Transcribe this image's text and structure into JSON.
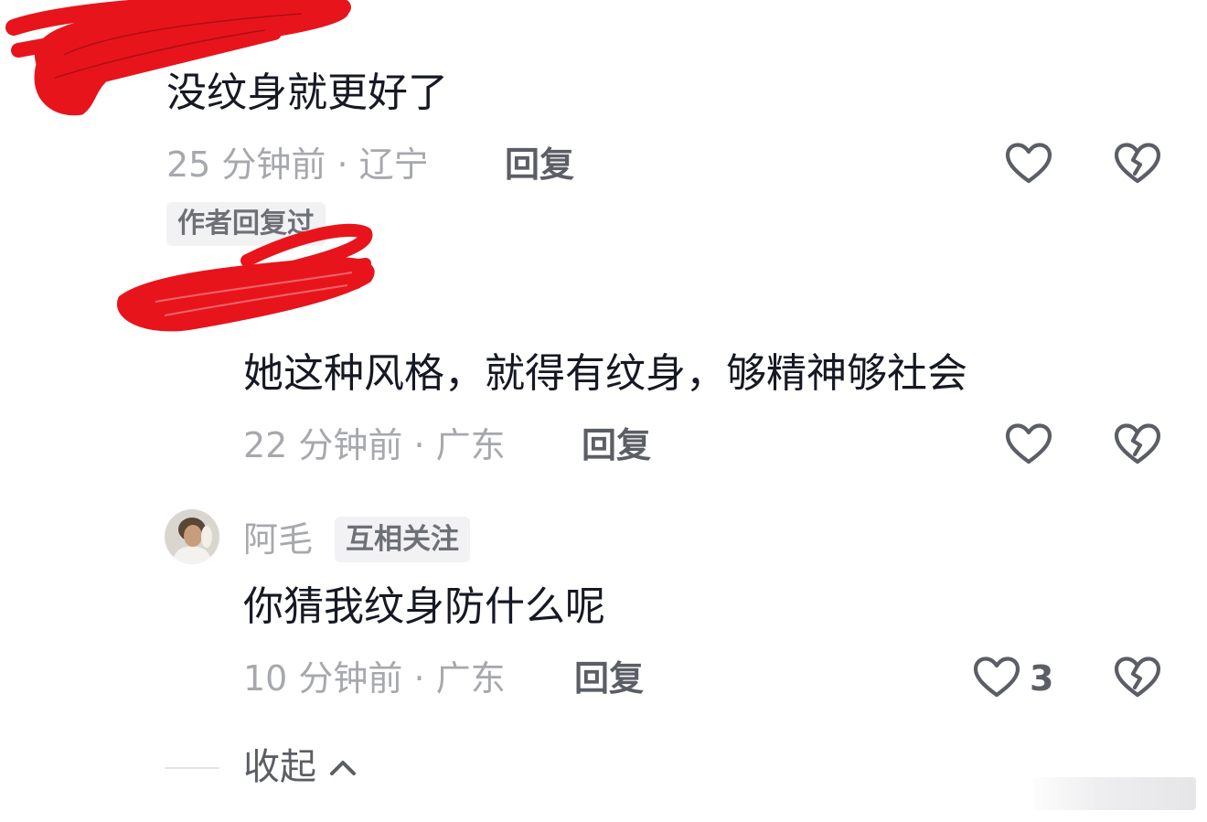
{
  "comments": [
    {
      "text": "没纹身就更好了",
      "meta": "25 分钟前 · 辽宁",
      "reply_label": "回复",
      "author_tag": "作者回复过"
    },
    {
      "text": "她这种风格，就得有纹身，够精神够社会",
      "meta": "22 分钟前 · 广东",
      "reply_label": "回复"
    },
    {
      "username": "阿毛",
      "badge": "互相关注",
      "text": "你猜我纹身防什么呢",
      "meta": "10 分钟前 · 广东",
      "reply_label": "回复",
      "like_count": "3"
    }
  ],
  "collapse_label": "收起",
  "icons": {
    "like": "heart-outline-icon",
    "dislike": "broken-heart-icon",
    "collapse": "chevron-up-icon"
  },
  "colors": {
    "text_primary": "#161823",
    "text_secondary": "#a6a8ad",
    "reply": "#5c5e66",
    "redaction": "#e8141c"
  }
}
